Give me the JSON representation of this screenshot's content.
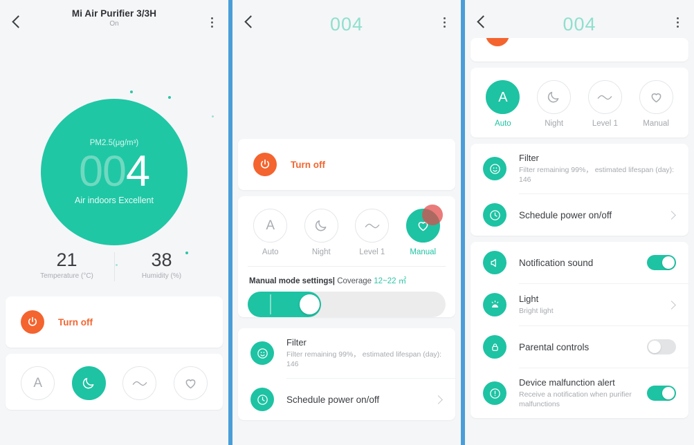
{
  "theme": {
    "accent_teal": "#1ec3a3",
    "accent_teal_light": "#8fe0cd",
    "accent_orange": "#f4642f",
    "cursor_red": "#e24848",
    "panel_divider_blue": "#4a9ed8",
    "bg": "#f5f6f8"
  },
  "panel1": {
    "header": {
      "title": "Mi Air Purifier 3/3H",
      "subtitle": "On",
      "back_icon": "back-arrow-icon",
      "menu_icon": "kebab-menu-icon"
    },
    "hero": {
      "pm_label": "PM2.5(μg/m³)",
      "value_dim": "00",
      "value_hi": "4",
      "status": "Air indoors Excellent"
    },
    "metrics": [
      {
        "value": "21",
        "caption": "Temperature (°C)"
      },
      {
        "value": "38",
        "caption": "Humidity (%)"
      }
    ],
    "power": {
      "label": "Turn off",
      "icon": "power-icon"
    },
    "modes": [
      {
        "label": "A",
        "name": "auto",
        "selected": false,
        "icon": "letter-a-icon"
      },
      {
        "label": "",
        "name": "night",
        "selected": true,
        "icon": "moon-icon"
      },
      {
        "label": "",
        "name": "level1",
        "selected": false,
        "icon": "wave-icon"
      },
      {
        "label": "",
        "name": "manual",
        "selected": false,
        "icon": "heart-icon"
      }
    ]
  },
  "panel2": {
    "header": {
      "title": "004",
      "back_icon": "back-arrow-icon",
      "menu_icon": "kebab-menu-icon"
    },
    "power": {
      "label": "Turn off",
      "icon": "power-icon"
    },
    "modes": [
      {
        "label": "Auto",
        "selected": false,
        "icon": "letter-a-icon"
      },
      {
        "label": "Night",
        "selected": false,
        "icon": "moon-icon"
      },
      {
        "label": "Level 1",
        "selected": false,
        "icon": "wave-icon"
      },
      {
        "label": "Manual",
        "selected": true,
        "icon": "heart-icon"
      }
    ],
    "manual_settings": {
      "title": "Manual mode settings",
      "separator": "|",
      "coverage_label": "Coverage",
      "coverage_value": "12~22 ㎡",
      "slider_fill_percent": 37
    },
    "rows": [
      {
        "title": "Filter",
        "subtitle": "Filter remaining 99%， estimated lifespan (day): 146",
        "icon": "filter-icon",
        "control": "none"
      },
      {
        "title": "Schedule power on/off",
        "subtitle": "",
        "icon": "clock-icon",
        "control": "chevron"
      }
    ]
  },
  "panel3": {
    "header": {
      "title": "004",
      "back_icon": "back-arrow-icon",
      "menu_icon": "kebab-menu-icon"
    },
    "modes": [
      {
        "label": "Auto",
        "selected": true,
        "icon": "letter-a-icon"
      },
      {
        "label": "Night",
        "selected": false,
        "icon": "moon-icon"
      },
      {
        "label": "Level 1",
        "selected": false,
        "icon": "wave-icon"
      },
      {
        "label": "Manual",
        "selected": false,
        "icon": "heart-icon"
      }
    ],
    "rows": [
      {
        "title": "Filter",
        "subtitle": "Filter remaining 99%， estimated lifespan (day): 146",
        "icon": "filter-icon",
        "control": "none"
      },
      {
        "title": "Schedule power on/off",
        "subtitle": "",
        "icon": "clock-icon",
        "control": "chevron"
      },
      {
        "title": "Notification sound",
        "subtitle": "",
        "icon": "speaker-icon",
        "control": "toggle-on"
      },
      {
        "title": "Light",
        "subtitle": "Bright light",
        "icon": "light-icon",
        "control": "chevron"
      },
      {
        "title": "Parental controls",
        "subtitle": "",
        "icon": "lock-icon",
        "control": "toggle-off"
      },
      {
        "title": "Device malfunction alert",
        "subtitle": "Receive a notification when purifier malfunctions",
        "icon": "alert-icon",
        "control": "toggle-on"
      }
    ]
  }
}
